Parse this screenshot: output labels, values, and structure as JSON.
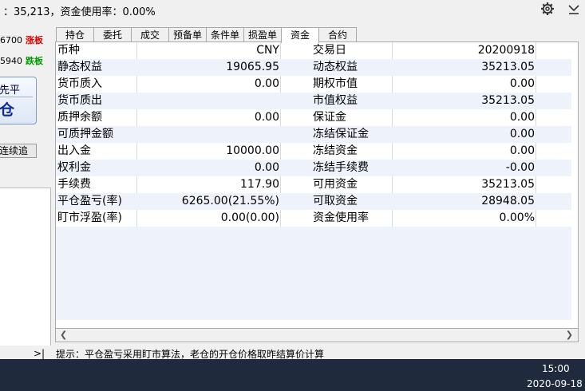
{
  "status_bar": {
    "text": "：35,213，资金使用率：0.00%"
  },
  "left_panel": {
    "quotes": [
      {
        "value": "6700",
        "label": "涨板",
        "color": "#e00000"
      },
      {
        "value": "5940",
        "label": "跌板",
        "color": "#009a00"
      }
    ],
    "close_button": {
      "line1": "先平",
      "line2": "仓"
    },
    "chase_button": "连续追",
    "more_arrow": ">|"
  },
  "tabs": [
    {
      "label": "持仓",
      "active": false
    },
    {
      "label": "委托",
      "active": false
    },
    {
      "label": "成交",
      "active": false
    },
    {
      "label": "预备单",
      "active": false
    },
    {
      "label": "条件单",
      "active": false
    },
    {
      "label": "损盈单",
      "active": false
    },
    {
      "label": "资金",
      "active": true
    },
    {
      "label": "合约",
      "active": false
    }
  ],
  "funds": [
    {
      "label1": "币种",
      "value1": "CNY",
      "label2": "交易日",
      "value2": "20200918"
    },
    {
      "label1": "静态权益",
      "value1": "19065.95",
      "label2": "动态权益",
      "value2": "35213.05"
    },
    {
      "label1": "货币质入",
      "value1": "0.00",
      "label2": "期权市值",
      "value2": "0.00"
    },
    {
      "label1": "货币质出",
      "value1": "",
      "label2": "市值权益",
      "value2": "35213.05"
    },
    {
      "label1": "质押余额",
      "value1": "0.00",
      "label2": "保证金",
      "value2": "0.00"
    },
    {
      "label1": "可质押金额",
      "value1": "",
      "label2": "冻结保证金",
      "value2": "0.00"
    },
    {
      "label1": "出入金",
      "value1": "10000.00",
      "label2": "冻结资金",
      "value2": "0.00"
    },
    {
      "label1": "权利金",
      "value1": "0.00",
      "label2": "冻结手续费",
      "value2": "-0.00"
    },
    {
      "label1": "手续费",
      "value1": "117.90",
      "label2": "可用资金",
      "value2": "35213.05"
    },
    {
      "label1": "平仓盈亏(率)",
      "value1": "6265.00(21.55%)",
      "label2": "可取资金",
      "value2": "28948.05"
    },
    {
      "label1": "盯市浮盈(率)",
      "value1": "0.00(0.00)",
      "label2": "资金使用率",
      "value2": "0.00%"
    }
  ],
  "hint": "提示：平仓盈亏采用盯市算法，老仓的开仓价格取昨结算价计算",
  "taskbar": {
    "time": "15:00",
    "date": "2020-09-18"
  },
  "icons": {
    "settings": "gear-icon",
    "collapse": "chevron-down-icon"
  }
}
